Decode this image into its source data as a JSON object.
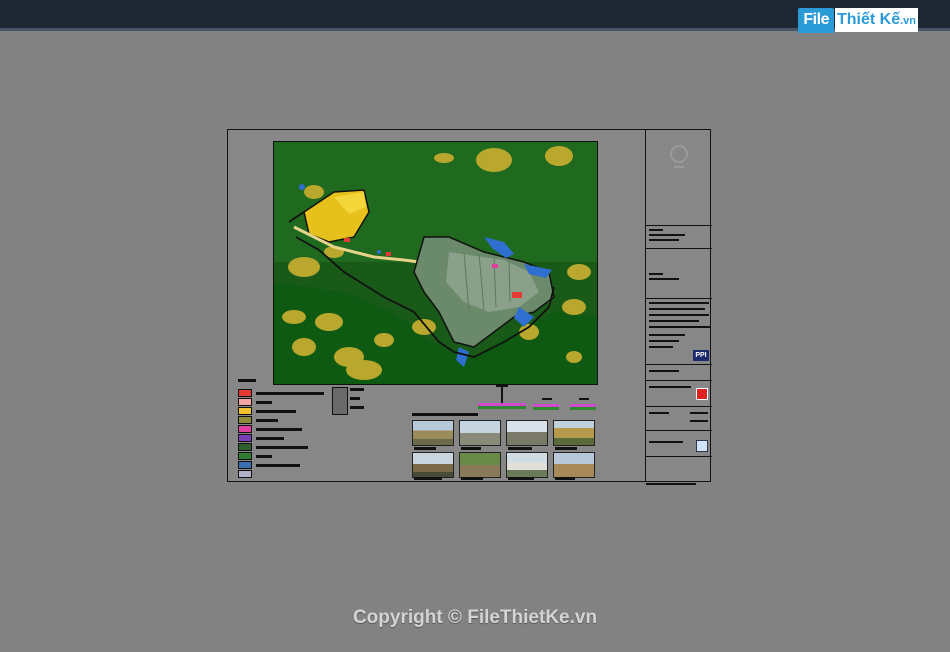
{
  "header": {
    "logo_file": "File",
    "logo_rest": "Thiết Kế",
    "logo_vn": ".vn"
  },
  "title_block": {
    "badge": "PPI"
  },
  "legend": {
    "swatch_colors": [
      "#e53935",
      "#f4a6a6",
      "#f2c12e",
      "#8c8c3a",
      "#e040a0",
      "#7b3fb5",
      "#2f5f2f",
      "#2e7d32",
      "#3a6fb0",
      "#b0b0c8"
    ]
  },
  "footer": {
    "copyright": "Copyright © FileThietKe.vn"
  },
  "colors": {
    "background": "#828282",
    "topbar": "#1f2733",
    "accent": "#2a9bd6",
    "map_green": "#1e6b1e",
    "map_yellow": "#c8b23a"
  }
}
